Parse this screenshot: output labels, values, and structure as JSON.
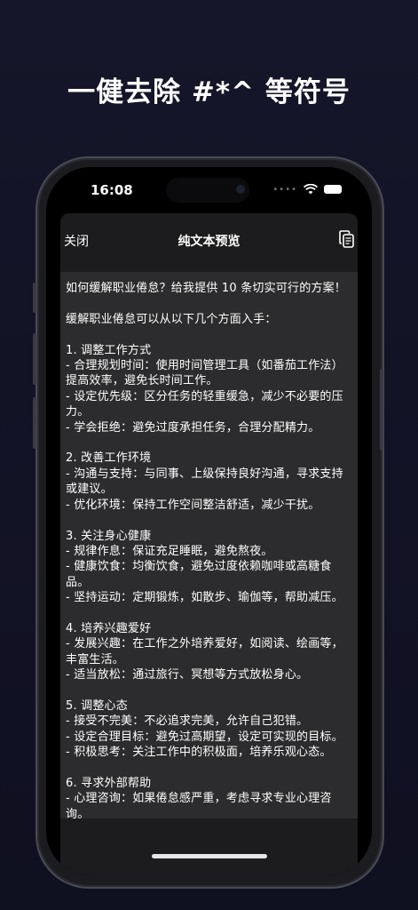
{
  "headline": "一健去除 #*^ 等符号",
  "status_bar": {
    "time": "16:08"
  },
  "nav": {
    "close_label": "关闭",
    "title": "纯文本预览"
  },
  "icons": {
    "copy": "copy-icon",
    "wifi": "wifi-icon",
    "battery": "battery-icon"
  },
  "content": "如何缓解职业倦怠？给我提供 10 条切实可行的方案！\n\n缓解职业倦怠可以从以下几个方面入手：\n\n1. 调整工作方式\n- 合理规划时间：使用时间管理工具（如番茄工作法）提高效率，避免长时间工作。\n- 设定优先级：区分任务的轻重缓急，减少不必要的压力。\n- 学会拒绝：避免过度承担任务，合理分配精力。\n\n2. 改善工作环境\n- 沟通与支持：与同事、上级保持良好沟通，寻求支持或建议。\n- 优化环境：保持工作空间整洁舒适，减少干扰。\n\n3. 关注身心健康\n- 规律作息：保证充足睡眠，避免熬夜。\n- 健康饮食：均衡饮食，避免过度依赖咖啡或高糖食品。\n- 坚持运动：定期锻炼，如散步、瑜伽等，帮助减压。\n\n4. 培养兴趣爱好\n- 发展兴趣：在工作之外培养爱好，如阅读、绘画等，丰富生活。\n- 适当放松：通过旅行、冥想等方式放松身心。\n\n5. 调整心态\n- 接受不完美：不必追求完美，允许自己犯错。\n- 设定合理目标：避免过高期望，设定可实现的目标。\n- 积极思考：关注工作中的积极面，培养乐观心态。\n\n6. 寻求外部帮助\n- 心理咨询：如果倦怠感严重，考虑寻求专业心理咨询。\n- 职业规划：与职业顾问讨论，探索新的职业方向或调整目标。"
}
